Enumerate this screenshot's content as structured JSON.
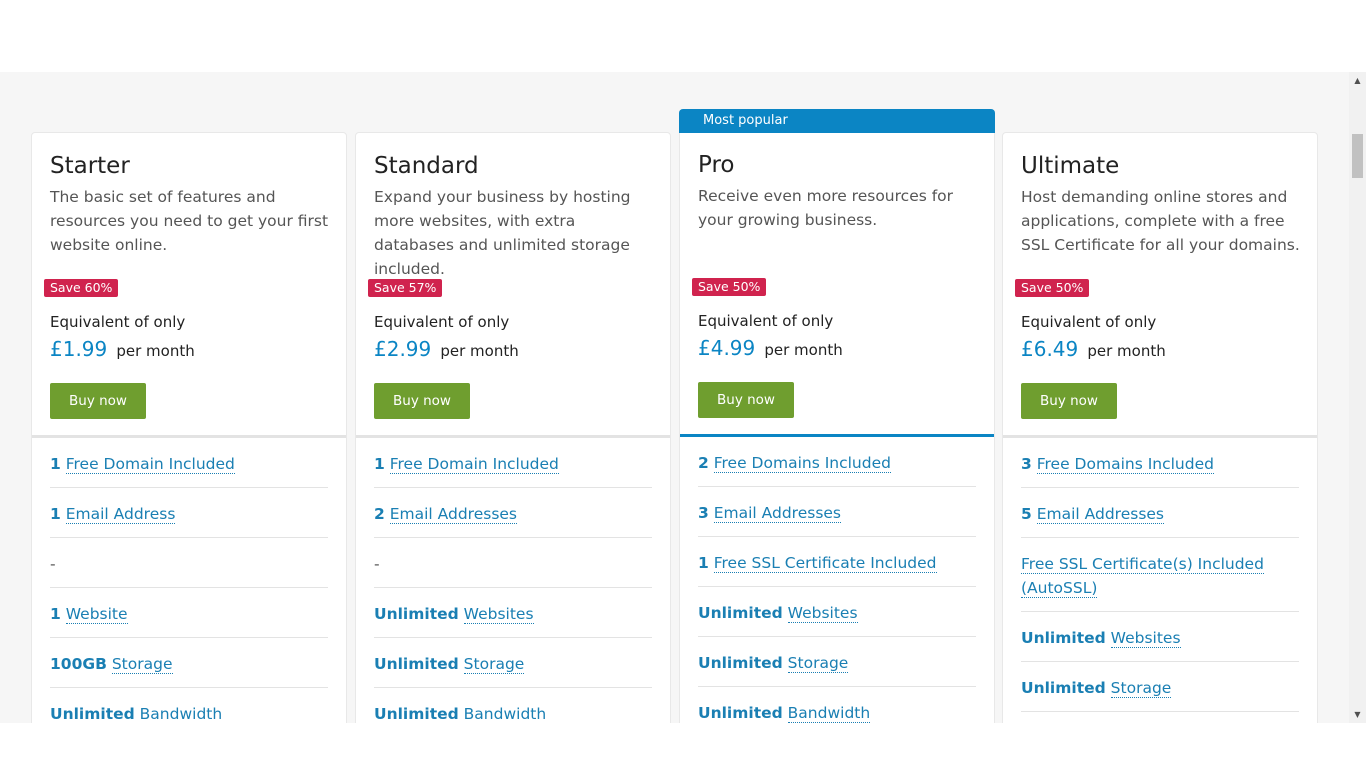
{
  "popular_label": "Most popular",
  "colors": {
    "accent": "#0b85c4",
    "save_badge": "#d0234e",
    "buy_button": "#6f9e2f"
  },
  "plans": [
    {
      "name": "Starter",
      "description": "The basic set of features and resources you need to get your first website online.",
      "save": "Save 60%",
      "equivalent": "Equivalent of only",
      "price": "£1.99",
      "per": "per month",
      "button": "Buy now",
      "features": [
        {
          "num": "1",
          "label": "Free Domain Included"
        },
        {
          "num": "1",
          "label": "Email Address"
        },
        {
          "num": "",
          "label": "-"
        },
        {
          "num": "1",
          "label": "Website"
        },
        {
          "num": "100GB",
          "label": "Storage"
        },
        {
          "num": "Unlimited",
          "label": "Bandwidth"
        }
      ]
    },
    {
      "name": "Standard",
      "description": "Expand your business by hosting more websites, with extra databases and unlimited storage included.",
      "save": "Save 57%",
      "equivalent": "Equivalent of only",
      "price": "£2.99",
      "per": "per month",
      "button": "Buy now",
      "features": [
        {
          "num": "1",
          "label": "Free Domain Included"
        },
        {
          "num": "2",
          "label": "Email Addresses"
        },
        {
          "num": "",
          "label": "-"
        },
        {
          "num": "Unlimited",
          "label": "Websites"
        },
        {
          "num": "Unlimited",
          "label": "Storage"
        },
        {
          "num": "Unlimited",
          "label": "Bandwidth"
        }
      ]
    },
    {
      "name": "Pro",
      "description": "Receive even more resources for your growing business.",
      "save": "Save 50%",
      "equivalent": "Equivalent of only",
      "price": "£4.99",
      "per": "per month",
      "button": "Buy now",
      "features": [
        {
          "num": "2",
          "label": "Free Domains Included"
        },
        {
          "num": "3",
          "label": "Email Addresses"
        },
        {
          "num": "1",
          "label": "Free SSL Certificate Included"
        },
        {
          "num": "Unlimited",
          "label": "Websites"
        },
        {
          "num": "Unlimited",
          "label": "Storage"
        },
        {
          "num": "Unlimited",
          "label": "Bandwidth"
        }
      ]
    },
    {
      "name": "Ultimate",
      "description": "Host demanding online stores and applications, complete with a free SSL Certificate for all your domains.",
      "save": "Save 50%",
      "equivalent": "Equivalent of only",
      "price": "£6.49",
      "per": "per month",
      "button": "Buy now",
      "features": [
        {
          "num": "3",
          "label": "Free Domains Included"
        },
        {
          "num": "5",
          "label": "Email Addresses"
        },
        {
          "num": "",
          "label": "Free SSL Certificate(s) Included (AutoSSL)"
        },
        {
          "num": "Unlimited",
          "label": "Websites"
        },
        {
          "num": "Unlimited",
          "label": "Storage"
        }
      ]
    }
  ]
}
